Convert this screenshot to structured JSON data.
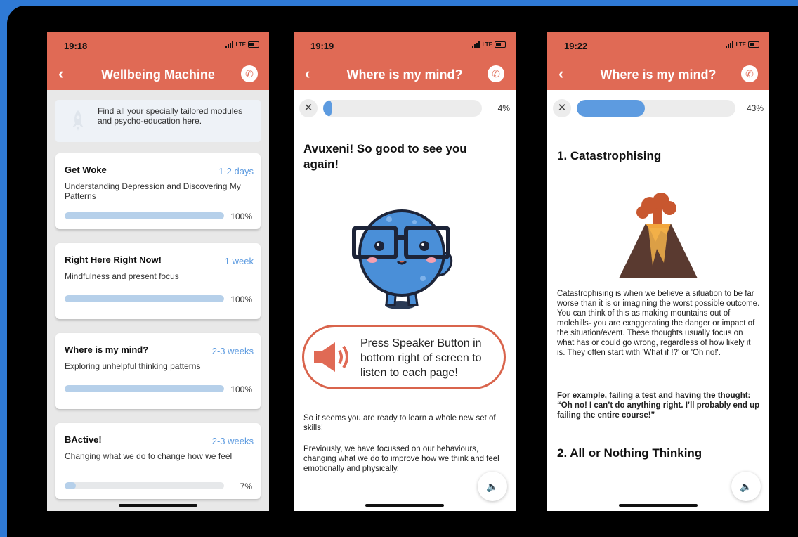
{
  "screens": [
    {
      "time": "19:18",
      "network": "LTE",
      "title": "Wellbeing Machine",
      "info_text": "Find all your specially tailored modules and psycho-education here.",
      "modules": [
        {
          "title": "Get Woke",
          "duration": "1-2 days",
          "desc": "Understanding Depression and Discovering My Patterns",
          "progress": "100%",
          "progress_value": 100
        },
        {
          "title": "Right Here Right Now!",
          "duration": "1 week",
          "desc": "Mindfulness and present focus",
          "progress": "100%",
          "progress_value": 100
        },
        {
          "title": "Where is my mind?",
          "duration": "2-3 weeks",
          "desc": "Exploring unhelpful thinking patterns",
          "progress": "100%",
          "progress_value": 100
        },
        {
          "title": "BActive!",
          "duration": "2-3 weeks",
          "desc": "Changing what we do to change how we feel",
          "progress": "7%",
          "progress_value": 7
        }
      ]
    },
    {
      "time": "19:19",
      "network": "LTE",
      "title": "Where is my mind?",
      "progress": "4%",
      "progress_value": 4,
      "heading": "Avuxeni! So good to see you again!",
      "speaker_prompt": "Press Speaker Button in bottom right of screen to listen to each page!",
      "paragraphs": [
        "So it seems you are ready to learn a whole new set of skills!",
        "Previously, we have focussed on our behaviours, changing what we do to improve how we think and feel emotionally and physically."
      ]
    },
    {
      "time": "19:22",
      "network": "LTE",
      "title": "Where is my mind?",
      "progress": "43%",
      "progress_value": 43,
      "heading": "1. Catastrophising",
      "paragraph": "Catastrophising is when we believe a situation to be far worse than it is or imagining the worst possible outcome. You can think of this as making mountains out of molehills- you are exaggerating the danger or impact of the situation/event. These thoughts usually focus on what has or could go wrong, regardless of how likely it is. They often start with 'What if !?' or 'Oh no!'.",
      "example": "For example, failing a test and having the thought: “Oh no! I can’t do anything right. I’ll probably end up failing the entire course!”",
      "heading2": "2. All or Nothing Thinking"
    }
  ],
  "icons": {
    "back": "chevron-left-icon",
    "call": "phone-icon",
    "close": "close-icon",
    "speaker": "speaker-icon",
    "rocket": "rocket-icon"
  },
  "colors": {
    "header": "#e06a55",
    "accent_blue": "#5d9be0",
    "progress_light": "#b6d0ea",
    "speaker_orange": "#d9644c",
    "background": "#2f7ad6"
  }
}
